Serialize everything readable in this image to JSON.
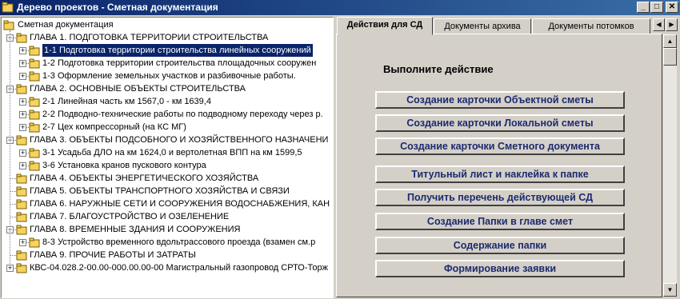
{
  "window": {
    "title": "Дерево проектов - Сметная документация",
    "buttons": {
      "minimize": "_",
      "maximize": "□",
      "close": "✕"
    }
  },
  "tree": {
    "root": "Сметная документация",
    "items": [
      {
        "label": "ГЛАВА 1.  ПОДГОТОВКА ТЕРРИТОРИИ СТРОИТЕЛЬСТВА",
        "level": 1,
        "expander": "−"
      },
      {
        "label": "1-1     Подготовка территории строительства линейных сооружений",
        "level": 2,
        "expander": "+",
        "selected": true
      },
      {
        "label": "1-2     Подготовка территории строительства площадочных сооружен",
        "level": 2,
        "expander": "+"
      },
      {
        "label": "1-3     Оформление земельных участков и разбивочные работы.",
        "level": 2,
        "expander": "+"
      },
      {
        "label": "ГЛАВА 2. ОСНОВНЫЕ ОБЪЕКТЫ СТРОИТЕЛЬСТВА",
        "level": 1,
        "expander": "−"
      },
      {
        "label": "2-1    Линейная часть км  1567,0 - км 1639,4",
        "level": 2,
        "expander": "+"
      },
      {
        "label": "2-2    Подводно-технические работы по подводному переходу через р.",
        "level": 2,
        "expander": "+"
      },
      {
        "label": "2-7    Цех компрессорный (на КС МГ)",
        "level": 2,
        "expander": "+"
      },
      {
        "label": "ГЛАВА 3. ОБЪЕКТЫ ПОДСОБНОГО И ХОЗЯЙСТВЕННОГО НАЗНАЧЕНИ",
        "level": 1,
        "expander": "−"
      },
      {
        "label": "3-1    Усадьба ДЛО на км 1624,0 и вертолетная ВПП на км 1599,5",
        "level": 2,
        "expander": "+"
      },
      {
        "label": "3-6    Установка кранов пускового контура",
        "level": 2,
        "expander": "+"
      },
      {
        "label": "ГЛАВА 4. ОБЪЕКТЫ ЭНЕРГЕТИЧЕСКОГО ХОЗЯЙСТВА",
        "level": 1,
        "expander": ""
      },
      {
        "label": "ГЛАВА 5. ОБЪЕКТЫ ТРАНСПОРТНОГО ХОЗЯЙСТВА И СВЯЗИ",
        "level": 1,
        "expander": ""
      },
      {
        "label": "ГЛАВА 6. НАРУЖНЫЕ СЕТИ И СООРУЖЕНИЯ ВОДОСНАБЖЕНИЯ, КАН",
        "level": 1,
        "expander": ""
      },
      {
        "label": "ГЛАВА 7.  БЛАГОУСТРОЙСТВО И ОЗЕЛЕНЕНИЕ",
        "level": 1,
        "expander": ""
      },
      {
        "label": "ГЛАВА 8. ВРЕМЕННЫЕ ЗДАНИЯ И СООРУЖЕНИЯ",
        "level": 1,
        "expander": "−"
      },
      {
        "label": "8-3    Устройство временного вдольтрассового проезда (взамен см.р",
        "level": 2,
        "expander": "+"
      },
      {
        "label": "ГЛАВА 9. ПРОЧИЕ РАБОТЫ И ЗАТРАТЫ",
        "level": 1,
        "expander": ""
      },
      {
        "label": "КВС-04.028.2-00.00-000.00.00-00    Магистральный газопровод СРТО-Торж",
        "level": 0,
        "expander": "+"
      }
    ]
  },
  "tabs": [
    {
      "label": "Действия для СД",
      "active": true
    },
    {
      "label": "Документы архива",
      "active": false
    },
    {
      "label": "Документы потомков",
      "active": false
    }
  ],
  "tab_scroll": {
    "left": "◀",
    "right": "▶"
  },
  "actions": {
    "heading": "Выполните действие",
    "buttons": [
      "Создание карточки Объектной сметы",
      "Создание карточки Локальной сметы",
      "Создание карточки Сметного документа",
      "Титульный лист и наклейка к папке",
      "Получить перечень действующей СД",
      "Создание Папки в главе смет",
      "Содержание папки",
      "Формирование заявки"
    ]
  },
  "scrollbar": {
    "up": "▲",
    "down": "▼"
  },
  "colors": {
    "titlebar": "#0a246a",
    "selection": "#0a246a",
    "button_text": "#1c2a6e",
    "face": "#d4d0c8"
  }
}
